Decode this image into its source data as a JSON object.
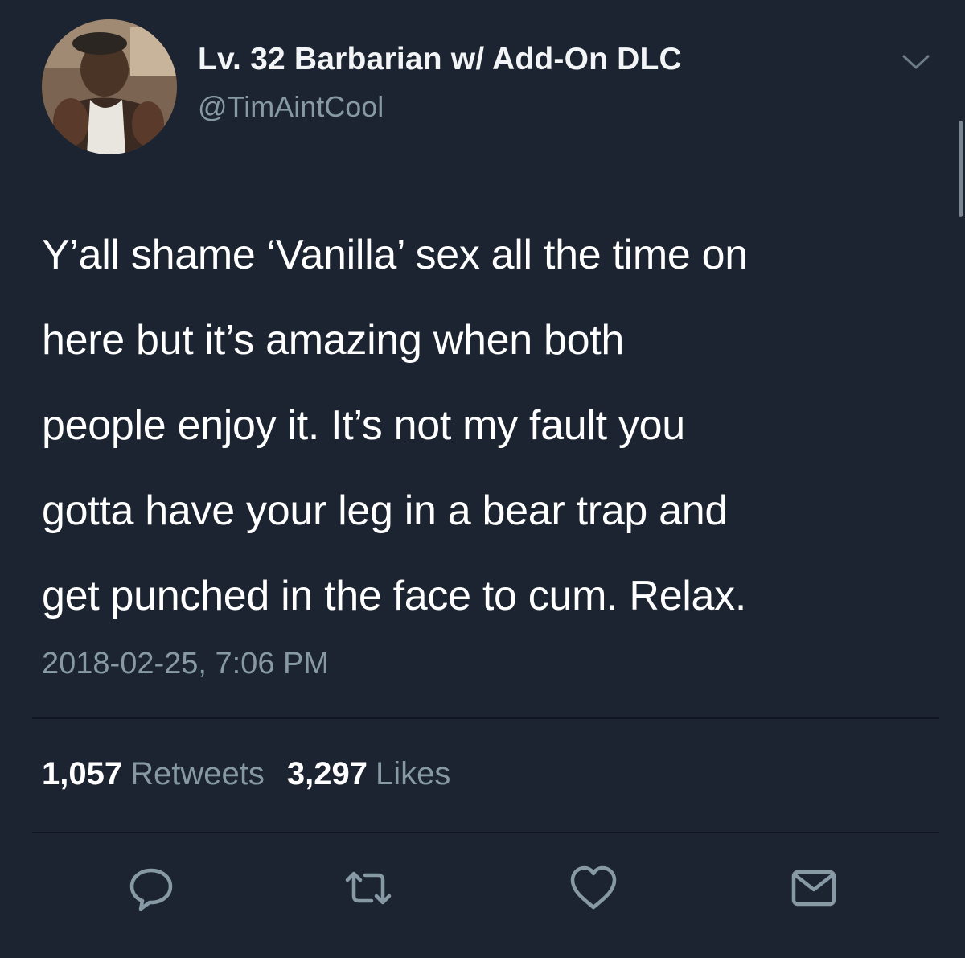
{
  "tweet": {
    "display_name": "Lv. 32 Barbarian w/ Add-On DLC",
    "handle": "@TimAintCool",
    "text_lines": [
      "Y’all shame ‘Vanilla’ sex all the time on",
      "here but it’s amazing when both",
      "people enjoy it. It’s not my fault you",
      "gotta have your leg in a bear trap and",
      "get punched in the face to cum. Relax."
    ],
    "timestamp": "2018-02-25, 7:06 PM",
    "stats": {
      "retweets_count": "1,057",
      "retweets_label": "Retweets",
      "likes_count": "3,297",
      "likes_label": "Likes"
    }
  },
  "icons": {
    "menu": "chevron-down-icon",
    "reply": "reply-icon",
    "retweet": "retweet-icon",
    "like": "heart-icon",
    "message": "envelope-icon"
  },
  "colors": {
    "background": "#1b2430",
    "primary_text": "#ffffff",
    "secondary_text": "#8899a6",
    "divider": "#0f1620"
  }
}
